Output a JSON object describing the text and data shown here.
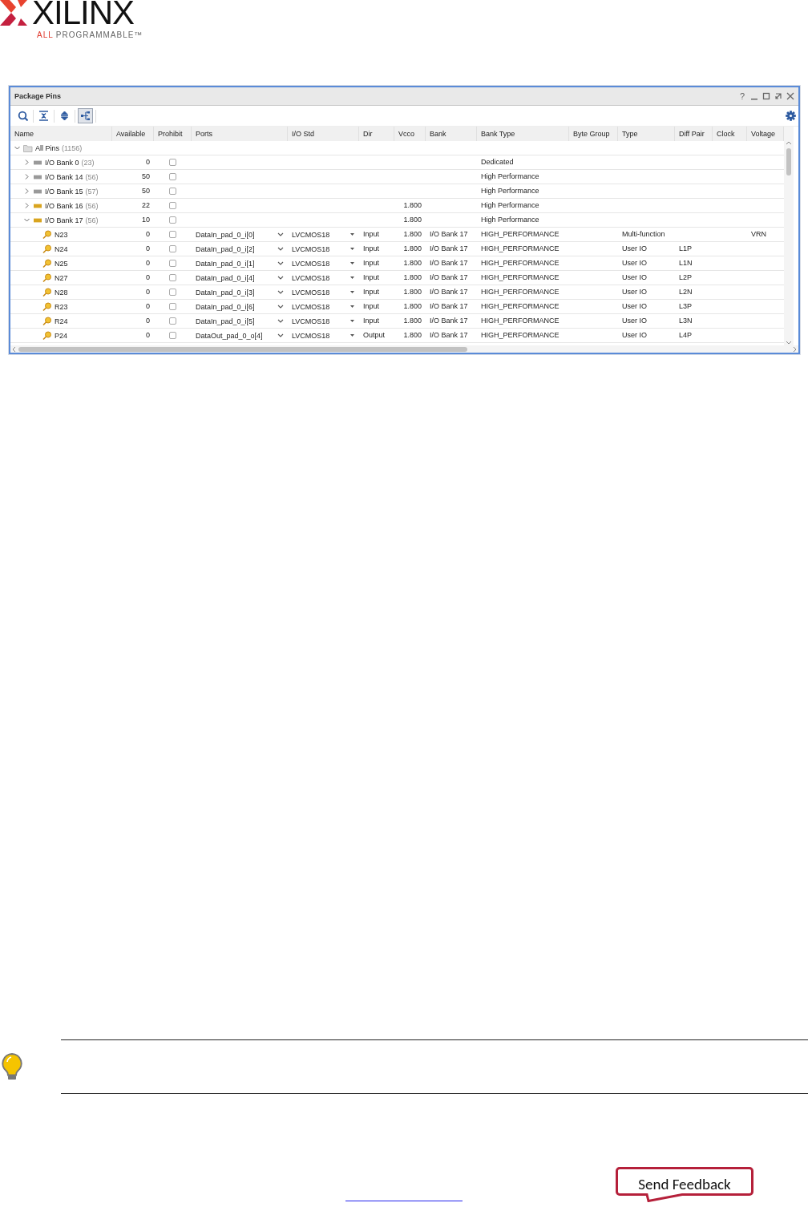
{
  "logo": {
    "wordmark": "XILINX",
    "tagline_accent": "ALL",
    "tagline": "PROGRAMMABLE™"
  },
  "window": {
    "title": "Package Pins",
    "controls": [
      {
        "kind": "help",
        "label": "?"
      },
      {
        "kind": "minimize"
      },
      {
        "kind": "maximize"
      },
      {
        "kind": "float"
      },
      {
        "kind": "close"
      }
    ]
  },
  "toolbar": [
    {
      "kind": "search",
      "selected": false
    },
    {
      "kind": "collapse",
      "selected": false
    },
    {
      "kind": "expand",
      "selected": false
    },
    {
      "kind": "group",
      "selected": true
    }
  ],
  "columns": [
    "Name",
    "Available",
    "Prohibit",
    "Ports",
    "I/O Std",
    "Dir",
    "Vcco",
    "Bank",
    "Bank Type",
    "Byte Group",
    "Type",
    "Diff Pair",
    "Clock",
    "Voltage"
  ],
  "tree": {
    "name": "All Pins",
    "count": "(1156)",
    "expanded": true,
    "children": [
      {
        "name": "I/O Bank 0",
        "count": "(23)",
        "expanded": false,
        "color": "#9a9a9a",
        "available": "0",
        "prohibited": false,
        "bank_type": "Dedicated"
      },
      {
        "name": "I/O Bank 14",
        "count": "(56)",
        "expanded": false,
        "color": "#9a9a9a",
        "available": "50",
        "prohibited": false,
        "bank_type": "High Performance"
      },
      {
        "name": "I/O Bank 15",
        "count": "(57)",
        "expanded": false,
        "color": "#9a9a9a",
        "available": "50",
        "prohibited": false,
        "bank_type": "High Performance"
      },
      {
        "name": "I/O Bank 16",
        "count": "(56)",
        "expanded": false,
        "color": "#d9a520",
        "available": "22",
        "prohibited": false,
        "vcco": "1.800",
        "bank_type": "High Performance"
      },
      {
        "name": "I/O Bank 17",
        "count": "(56)",
        "expanded": true,
        "color": "#d9a520",
        "available": "10",
        "prohibited": false,
        "vcco": "1.800",
        "bank_type": "High Performance",
        "children": [
          {
            "name": "N23",
            "available": "0",
            "prohibited": false,
            "port": "DataIn_pad_0_i[0]",
            "io_std": "LVCMOS18",
            "dir": "Input",
            "vcco": "1.800",
            "bank": "I/O Bank 17",
            "bank_type": "HIGH_PERFORMANCE",
            "type": "Multi-function",
            "voltage": "VRN"
          },
          {
            "name": "N24",
            "available": "0",
            "prohibited": false,
            "port": "DataIn_pad_0_i[2]",
            "io_std": "LVCMOS18",
            "dir": "Input",
            "vcco": "1.800",
            "bank": "I/O Bank 17",
            "bank_type": "HIGH_PERFORMANCE",
            "type": "User IO",
            "diff_pair": "L1P"
          },
          {
            "name": "N25",
            "available": "0",
            "prohibited": false,
            "port": "DataIn_pad_0_i[1]",
            "io_std": "LVCMOS18",
            "dir": "Input",
            "vcco": "1.800",
            "bank": "I/O Bank 17",
            "bank_type": "HIGH_PERFORMANCE",
            "type": "User IO",
            "diff_pair": "L1N"
          },
          {
            "name": "N27",
            "available": "0",
            "prohibited": false,
            "port": "DataIn_pad_0_i[4]",
            "io_std": "LVCMOS18",
            "dir": "Input",
            "vcco": "1.800",
            "bank": "I/O Bank 17",
            "bank_type": "HIGH_PERFORMANCE",
            "type": "User IO",
            "diff_pair": "L2P"
          },
          {
            "name": "N28",
            "available": "0",
            "prohibited": false,
            "port": "DataIn_pad_0_i[3]",
            "io_std": "LVCMOS18",
            "dir": "Input",
            "vcco": "1.800",
            "bank": "I/O Bank 17",
            "bank_type": "HIGH_PERFORMANCE",
            "type": "User IO",
            "diff_pair": "L2N"
          },
          {
            "name": "R23",
            "available": "0",
            "prohibited": false,
            "port": "DataIn_pad_0_i[6]",
            "io_std": "LVCMOS18",
            "dir": "Input",
            "vcco": "1.800",
            "bank": "I/O Bank 17",
            "bank_type": "HIGH_PERFORMANCE",
            "type": "User IO",
            "diff_pair": "L3P"
          },
          {
            "name": "R24",
            "available": "0",
            "prohibited": false,
            "port": "DataIn_pad_0_i[5]",
            "io_std": "LVCMOS18",
            "dir": "Input",
            "vcco": "1.800",
            "bank": "I/O Bank 17",
            "bank_type": "HIGH_PERFORMANCE",
            "type": "User IO",
            "diff_pair": "L3N"
          },
          {
            "name": "P24",
            "available": "0",
            "prohibited": false,
            "port": "DataOut_pad_0_o[4]",
            "io_std": "LVCMOS18",
            "dir": "Output",
            "vcco": "1.800",
            "bank": "I/O Bank 17",
            "bank_type": "HIGH_PERFORMANCE",
            "type": "User IO",
            "diff_pair": "L4P"
          }
        ]
      }
    ]
  },
  "feedback_button": "Send Feedback"
}
